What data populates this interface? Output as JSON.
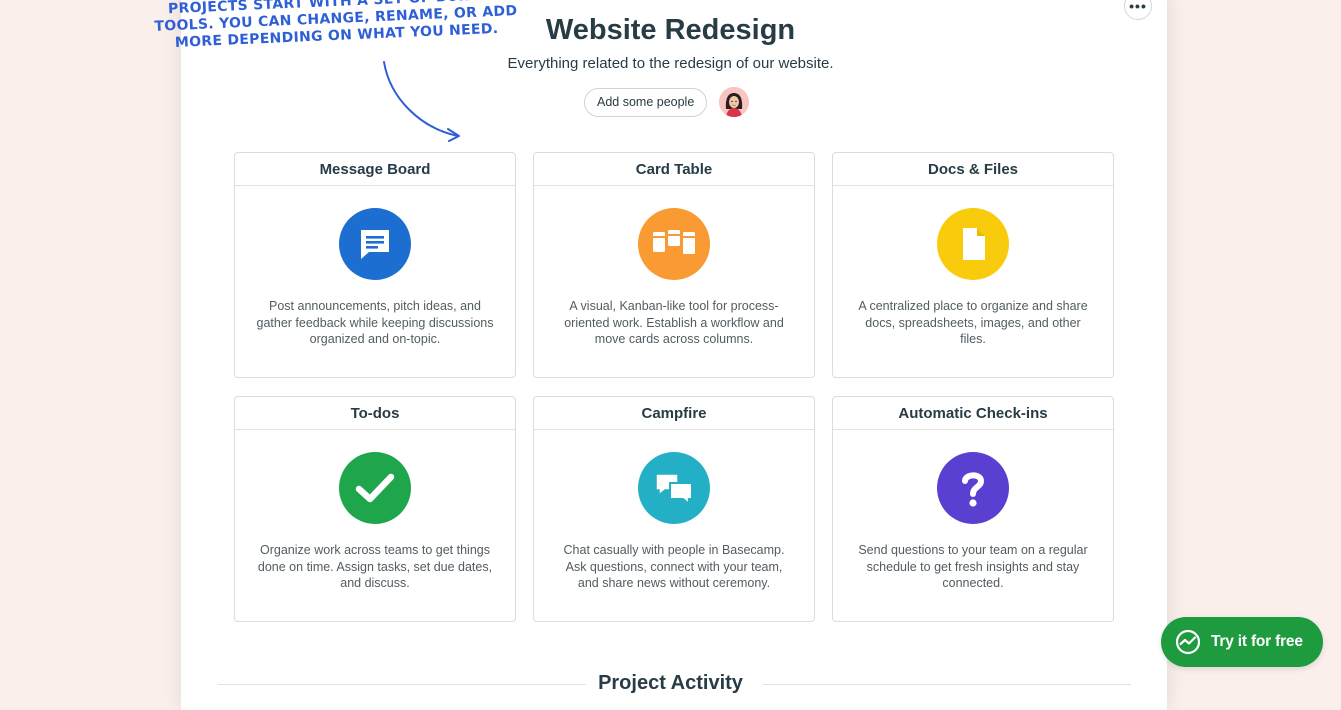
{
  "annotation": {
    "text": "PROJECTS START WITH A SET OF BUILT-IN TOOLS. YOU CAN CHANGE, RENAME, OR ADD MORE DEPENDING ON WHAT YOU NEED."
  },
  "header": {
    "menu_icon": "more-dots-icon",
    "title": "Website Redesign",
    "subtitle": "Everything related to the redesign of our website.",
    "add_people_label": "Add some people"
  },
  "tools": [
    {
      "name": "Message Board",
      "icon": "message-board-icon",
      "color": "#1c6fd1",
      "description": "Post announcements, pitch ideas, and gather feedback while keeping discussions organized and on-topic."
    },
    {
      "name": "Card Table",
      "icon": "card-table-icon",
      "color": "#f99a32",
      "description": "A visual, Kanban-like tool for process-oriented work. Establish a workflow and move cards across columns."
    },
    {
      "name": "Docs & Files",
      "icon": "document-icon",
      "color": "#f8cc0c",
      "description": "A centralized place to organize and share docs, spreadsheets, images, and other files."
    },
    {
      "name": "To-dos",
      "icon": "checkmark-icon",
      "color": "#1fa64d",
      "description": "Organize work across teams to get things done on time. Assign tasks, set due dates, and discuss."
    },
    {
      "name": "Campfire",
      "icon": "chat-bubbles-icon",
      "color": "#23b0c6",
      "description": "Chat casually with people in Basecamp. Ask questions, connect with your team, and share news without ceremony."
    },
    {
      "name": "Automatic Check-ins",
      "icon": "question-mark-icon",
      "color": "#5a3fd1",
      "description": "Send questions to your team on a regular schedule to get fresh insights and stay connected."
    }
  ],
  "activity": {
    "title": "Project Activity"
  },
  "cta": {
    "label": "Try it for free",
    "icon": "basecamp-logo-icon",
    "color": "#1d9b3e"
  }
}
